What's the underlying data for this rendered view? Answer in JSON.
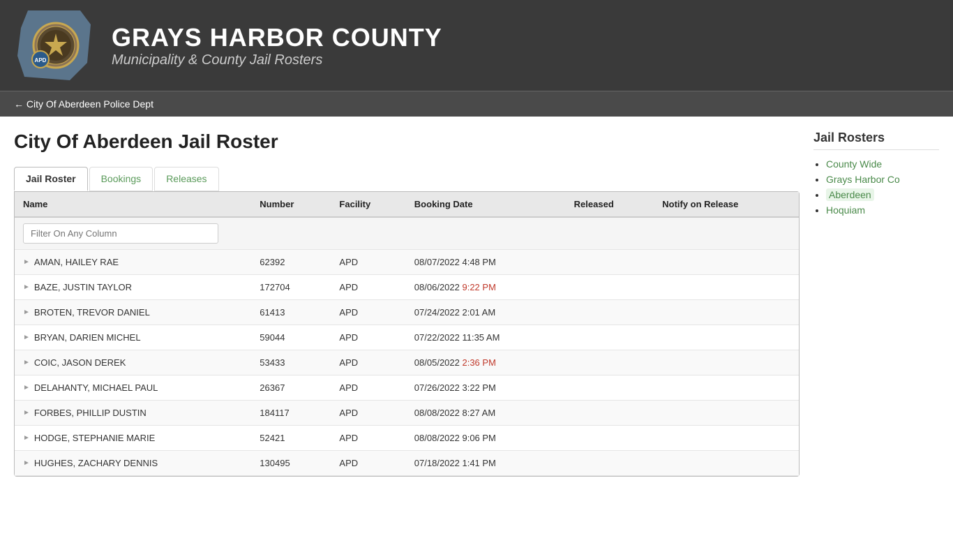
{
  "header": {
    "title": "GRAYS HARBOR COUNTY",
    "subtitle": "Municipality & County Jail Rosters"
  },
  "nav": {
    "back_label": "← City Of Aberdeen Police Dept"
  },
  "page": {
    "title": "City Of Aberdeen Jail Roster"
  },
  "tabs": [
    {
      "label": "Jail Roster",
      "active": true
    },
    {
      "label": "Bookings",
      "active": false
    },
    {
      "label": "Releases",
      "active": false
    }
  ],
  "table": {
    "columns": [
      "Name",
      "Number",
      "Facility",
      "Booking Date",
      "Released",
      "Notify on Release"
    ],
    "filter_placeholder": "Filter On Any Column",
    "rows": [
      {
        "name": "AMAN, HAILEY RAE",
        "number": "62392",
        "facility": "APD",
        "booking_date": "08/07/2022 4:48 PM",
        "released": "",
        "notify": ""
      },
      {
        "name": "BAZE, JUSTIN TAYLOR",
        "number": "172704",
        "facility": "APD",
        "booking_date": "08/06/2022 9:22 PM",
        "released": "",
        "notify": ""
      },
      {
        "name": "BROTEN, TREVOR DANIEL",
        "number": "61413",
        "facility": "APD",
        "booking_date": "07/24/2022 2:01 AM",
        "released": "",
        "notify": ""
      },
      {
        "name": "BRYAN, DARIEN MICHEL",
        "number": "59044",
        "facility": "APD",
        "booking_date": "07/22/2022 11:35 AM",
        "released": "",
        "notify": ""
      },
      {
        "name": "COIC, JASON DEREK",
        "number": "53433",
        "facility": "APD",
        "booking_date": "08/05/2022 2:36 PM",
        "released": "",
        "notify": ""
      },
      {
        "name": "DELAHANTY, MICHAEL PAUL",
        "number": "26367",
        "facility": "APD",
        "booking_date": "07/26/2022 3:22 PM",
        "released": "",
        "notify": ""
      },
      {
        "name": "FORBES, PHILLIP DUSTIN",
        "number": "184117",
        "facility": "APD",
        "booking_date": "08/08/2022 8:27 AM",
        "released": "",
        "notify": ""
      },
      {
        "name": "HODGE, STEPHANIE MARIE",
        "number": "52421",
        "facility": "APD",
        "booking_date": "08/08/2022 9:06 PM",
        "released": "",
        "notify": ""
      },
      {
        "name": "HUGHES, ZACHARY DENNIS",
        "number": "130495",
        "facility": "APD",
        "booking_date": "07/18/2022 1:41 PM",
        "released": "",
        "notify": ""
      }
    ]
  },
  "sidebar": {
    "title": "Jail Rosters",
    "links": [
      {
        "label": "County Wide",
        "active": false
      },
      {
        "label": "Grays Harbor Co",
        "active": false
      },
      {
        "label": "Aberdeen",
        "active": true
      },
      {
        "label": "Hoquiam",
        "active": false
      }
    ]
  }
}
